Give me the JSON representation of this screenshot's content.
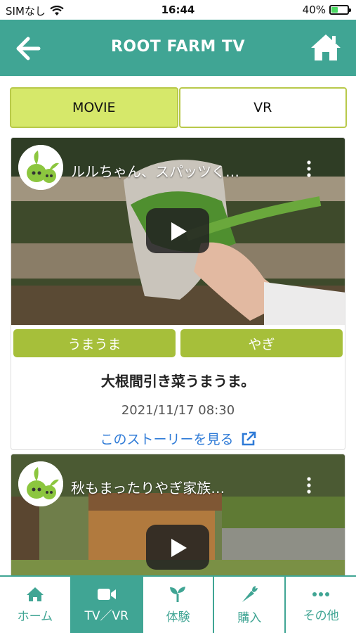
{
  "status_bar": {
    "carrier": "SIMなし",
    "time": "16:44",
    "battery": "40%",
    "battery_level": 0.4
  },
  "header": {
    "title": "ROOT FARM TV"
  },
  "segments": [
    {
      "label": "MOVIE",
      "active": true
    },
    {
      "label": "VR",
      "active": false
    }
  ],
  "stories": [
    {
      "video_title": "ルルちゃん、スパッツく…",
      "tags": [
        "うまうま",
        "やぎ"
      ],
      "title": "大根間引き菜うまうま。",
      "date": "2021/11/17 08:30",
      "link": "このストーリーを見る"
    },
    {
      "video_title": "秋もまったりやぎ家族…"
    }
  ],
  "tabs": [
    {
      "label": "ホーム",
      "icon": "home-icon"
    },
    {
      "label": "TV／VR",
      "icon": "video-camera-icon",
      "active": true
    },
    {
      "label": "体験",
      "icon": "sprout-icon"
    },
    {
      "label": "購入",
      "icon": "carrot-icon"
    },
    {
      "label": "その他",
      "icon": "more-dots-icon"
    }
  ],
  "colors": {
    "primary": "#40a594",
    "accent": "#d6e86a",
    "tag": "#a6bf3a",
    "link": "#2f7bd7"
  }
}
